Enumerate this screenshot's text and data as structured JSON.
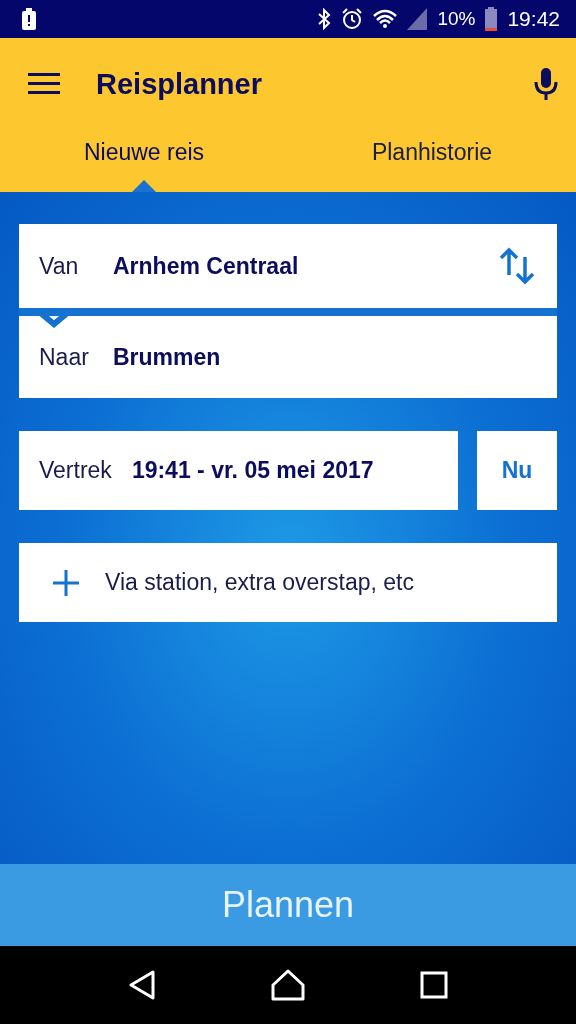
{
  "status_bar": {
    "battery_percent": "10%",
    "time": "19:42"
  },
  "toolbar": {
    "title": "Reisplanner"
  },
  "tabs": [
    {
      "label": "Nieuwe reis",
      "selected": true
    },
    {
      "label": "Planhistorie",
      "selected": false
    }
  ],
  "from": {
    "label": "Van",
    "value": "Arnhem Centraal"
  },
  "to": {
    "label": "Naar",
    "value": "Brummen"
  },
  "departure": {
    "label": "Vertrek",
    "value": "19:41 - vr. 05 mei 2017",
    "now_button": "Nu"
  },
  "via": {
    "label": "Via station, extra overstap, etc"
  },
  "plan_button": "Plannen"
}
